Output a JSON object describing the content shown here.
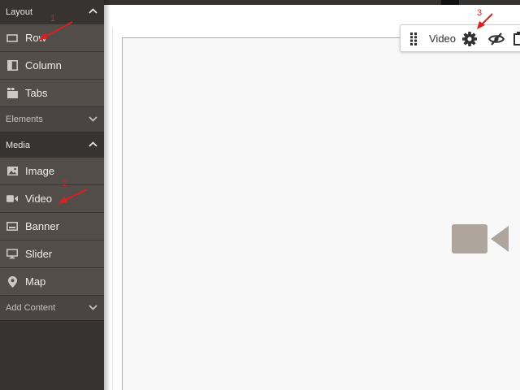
{
  "sidebar": {
    "groups": [
      {
        "label": "Layout",
        "expanded": true
      },
      {
        "label": "Elements",
        "expanded": false
      },
      {
        "label": "Media",
        "expanded": true
      },
      {
        "label": "Add Content",
        "expanded": false
      }
    ],
    "layout_items": [
      {
        "label": "Row",
        "icon": "row-icon"
      },
      {
        "label": "Column",
        "icon": "column-icon"
      },
      {
        "label": "Tabs",
        "icon": "tabs-icon"
      }
    ],
    "media_items": [
      {
        "label": "Image",
        "icon": "image-icon"
      },
      {
        "label": "Video",
        "icon": "video-camera-icon"
      },
      {
        "label": "Banner",
        "icon": "banner-icon"
      },
      {
        "label": "Slider",
        "icon": "slider-icon"
      },
      {
        "label": "Map",
        "icon": "map-pin-icon"
      }
    ]
  },
  "toolbar": {
    "label": "Video",
    "icons": [
      "drag-handle-icon",
      "gear-icon",
      "hide-eye-icon",
      "duplicate-icon"
    ]
  },
  "annotations": [
    "1",
    "2",
    "3"
  ],
  "colors": {
    "sidebar_bg": "#373330",
    "item_bg": "#524d49",
    "collapsed_header_bg": "#4a4542",
    "annotation_red": "#d82020",
    "placeholder_icon": "#aea59d"
  }
}
